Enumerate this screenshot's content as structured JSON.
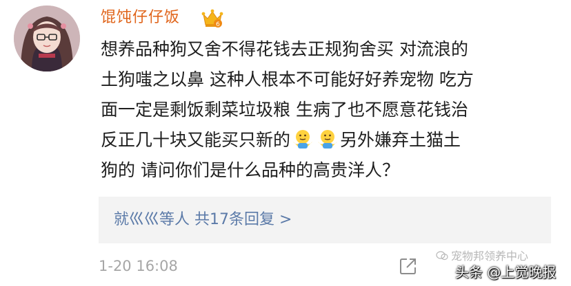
{
  "user": {
    "name": "馄饨仔仔饭",
    "avatar": "avatar-image",
    "badge": "vip-crown-icon"
  },
  "comment": {
    "lines": [
      "想养品种狗又舍不得花钱去正规狗舍买 对流浪的",
      "土狗嗤之以鼻 这种人根本不可能好好养宠物 吃方",
      "面一定是剩饭剩菜垃圾粮 生病了也不愿意花钱治",
      "反正几十块又能买只新的",
      "另外嫌弃土猫土",
      "狗的 请问你们是什么品种的高贵洋人？"
    ],
    "emoji": "shrug-emoji"
  },
  "replies": {
    "link_text": "就巛巛等人 共17条回复 >"
  },
  "meta": {
    "timestamp": "1-20 16:08",
    "share_icon": "share-icon"
  },
  "watermarks": {
    "wechat": "宠物邦领养中心",
    "toutiao": "头条 @上觉晚报"
  },
  "colors": {
    "username": "#e0641a",
    "reply_link": "#5b7aa8",
    "reply_bg": "#f3f3f3",
    "timestamp": "#a6a6a6"
  }
}
